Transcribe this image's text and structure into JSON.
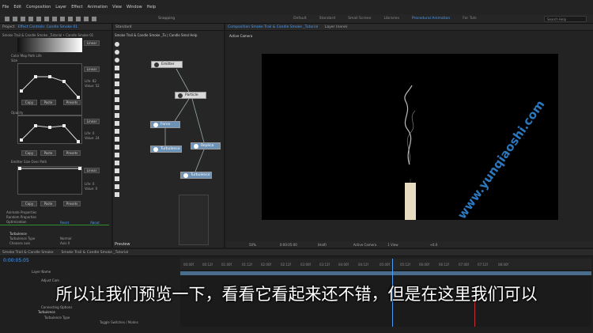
{
  "menu": [
    "File",
    "Edit",
    "Composition",
    "Layer",
    "Effect",
    "Animation",
    "View",
    "Window",
    "Help"
  ],
  "toolbar": {
    "snapping": "Snapping",
    "workspaces": [
      "Default",
      "Standard",
      "Small Screen",
      "Libraries",
      "Procedural Animation",
      "For Tuts"
    ],
    "active_workspace": "Procedural Animation",
    "search": "Search Help"
  },
  "left_panel": {
    "tab1": "Project",
    "tab2": "Effect Controls: Candle Smoke 01",
    "breadcrumb": "Smoke Trail & Candle Smoke _Tutorial • Candle Smoke 01",
    "sections": {
      "color": "Color Map Path Life",
      "size": "Size",
      "opacity": "Opacity",
      "emitter": "Emitter Size Over Path"
    },
    "graphs": [
      {
        "mode": "Linear",
        "life": "Life: 82",
        "value": "Value: 52"
      },
      {
        "mode": "Linear",
        "life": "Life: 0",
        "value": "Value: 24"
      },
      {
        "mode": "Linear",
        "life": "Life: 0",
        "value": "Value: 0"
      }
    ],
    "buttons": {
      "copy": "Copy",
      "paste": "Paste",
      "presets": "Presets"
    },
    "footer": [
      "Animate Properties",
      "Random Properties",
      "Optimization"
    ],
    "effect": "Turbulence",
    "reset": "Reset",
    "about": "About",
    "props": [
      {
        "name": "Turbulence Type",
        "value": "Normal"
      },
      {
        "name": "Chooses axis",
        "value": "Axis X"
      }
    ]
  },
  "mid_panel": {
    "title": "Standard",
    "path": "Smoke Trail & Candle Smoke _Tu   |   Candle Smol   Help",
    "nodes": [
      "Emitter",
      "Particle",
      "Force",
      "Turbulence",
      "Replica",
      "Turbulence"
    ]
  },
  "right_panel": {
    "tab": "Composition Smoke Trail & Candle Smoke _Tutorial",
    "layer_tab": "Layer (none)",
    "active_camera": "Active Camera",
    "footer": {
      "zoom": "50%",
      "timecode": "0:00:05:00",
      "quality": "(Half)",
      "camera": "Active Camera",
      "view": "1 View",
      "offset": "+0.0"
    }
  },
  "preview_label": "Preview",
  "timeline": {
    "tab1": "Smoke Trail & Candle Smoke",
    "tab2": "Smoke Trail & Candle Smoke _Tutorial",
    "timecode": "0:00:05:05",
    "ticks": [
      "00:00f",
      "00:12f",
      "01:00f",
      "01:12f",
      "02:00f",
      "02:12f",
      "03:00f",
      "03:12f",
      "04:00f",
      "04:12f",
      "05:00f",
      "05:12f",
      "06:00f",
      "06:12f",
      "07:00f",
      "07:12f",
      "08:00f"
    ],
    "layers": [
      "Layer Name",
      "Adjust Cam",
      "Connecting Options",
      "Turbulence",
      "Turbulence Type"
    ],
    "footer": "Toggle Switches / Modes"
  },
  "subtitle": "所以让我们预览一下，看看它看起来还不错，但是在这里我们可以",
  "watermark": "www.yunqiaoshi.com"
}
